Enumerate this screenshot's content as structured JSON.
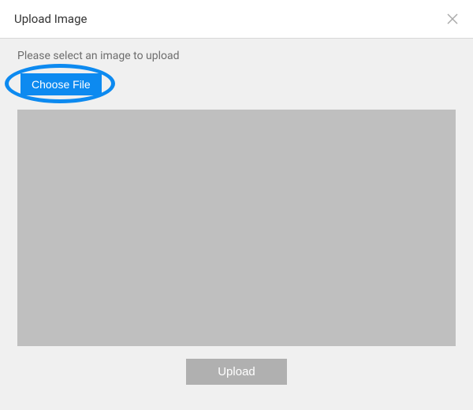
{
  "modal": {
    "title": "Upload Image",
    "instruction": "Please select an image to upload",
    "choose_file_label": "Choose File",
    "upload_label": "Upload"
  }
}
